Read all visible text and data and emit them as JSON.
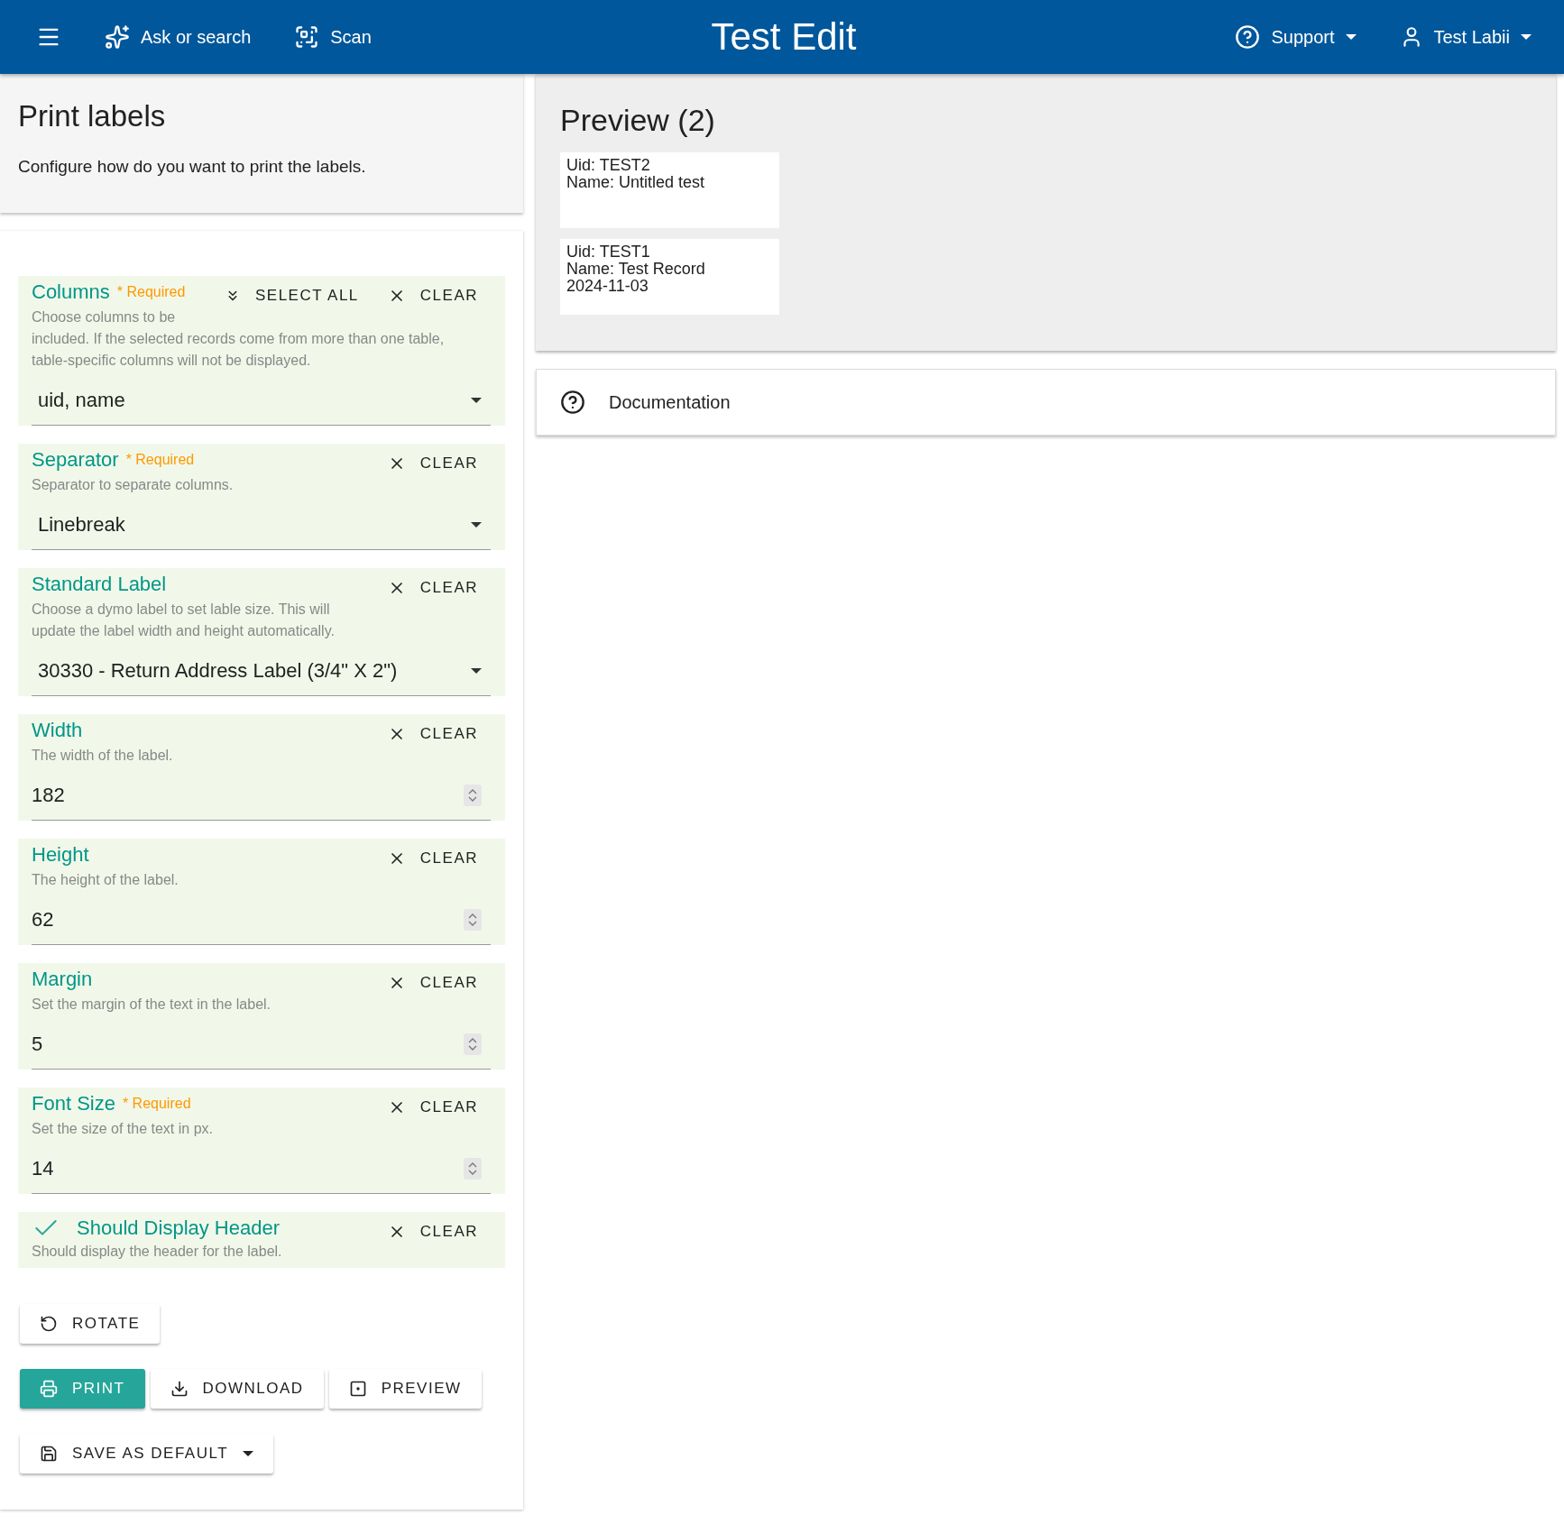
{
  "header": {
    "title": "Test Edit",
    "nav": [
      {
        "kind": "sparkle",
        "label": "Ask or search"
      },
      {
        "kind": "scan",
        "label": "Scan"
      }
    ],
    "support": "Support",
    "user": "Test Labii"
  },
  "intro": {
    "title": "Print labels",
    "subtitle": "Configure how do you want to print the labels."
  },
  "fields": [
    {
      "kind": "select",
      "label": "Columns",
      "required_note": "* Required",
      "select_all": "SELECT ALL",
      "clear": "CLEAR",
      "help": "Choose columns to be included. If the selected records come from more than one table, table-specific columns will not be displayed.",
      "value": "uid,  name"
    },
    {
      "kind": "select",
      "label": "Separator",
      "required_note": "* Required",
      "clear": "CLEAR",
      "help": "Separator to separate columns.",
      "value": "Linebreak"
    },
    {
      "kind": "select",
      "label": "Standard Label",
      "clear": "CLEAR",
      "help": "Choose a dymo label to set lable size. This will update the label width and height automatically.",
      "value": "30330 - Return Address Label (3/4\" X 2\")"
    },
    {
      "kind": "number",
      "label": "Width",
      "clear": "CLEAR",
      "help": "The width of the label.",
      "value": "182"
    },
    {
      "kind": "number",
      "label": "Height",
      "clear": "CLEAR",
      "help": "The height of the label.",
      "value": "62"
    },
    {
      "kind": "number",
      "label": "Margin",
      "clear": "CLEAR",
      "help": "Set the margin of the text in the label.",
      "value": "5"
    },
    {
      "kind": "number",
      "label": "Font Size",
      "required_note": "* Required",
      "clear": "CLEAR",
      "help": "Set the size of the text in px.",
      "value": "14"
    },
    {
      "kind": "checkbox",
      "label": "Should Display Header",
      "clear": "CLEAR",
      "help": "Should display the header for the label.",
      "checked": true
    }
  ],
  "actions": [
    [
      {
        "kind": "rotate",
        "label": "ROTATE",
        "primary": false
      }
    ],
    [
      {
        "kind": "print",
        "label": "PRINT",
        "primary": true
      },
      {
        "kind": "download",
        "label": "DOWNLOAD",
        "primary": false
      },
      {
        "kind": "preview",
        "label": "PREVIEW",
        "primary": false
      }
    ],
    [
      {
        "kind": "save",
        "label": "SAVE AS DEFAULT",
        "primary": false,
        "caret": true
      }
    ]
  ],
  "preview": {
    "title": "Preview (2)",
    "labels": [
      {
        "lines": [
          "Uid: TEST2",
          "Name: Untitled test"
        ]
      },
      {
        "lines": [
          "Uid: TEST1",
          "Name: Test Record",
          "2024-11-03"
        ]
      }
    ]
  },
  "documentation": "Documentation"
}
